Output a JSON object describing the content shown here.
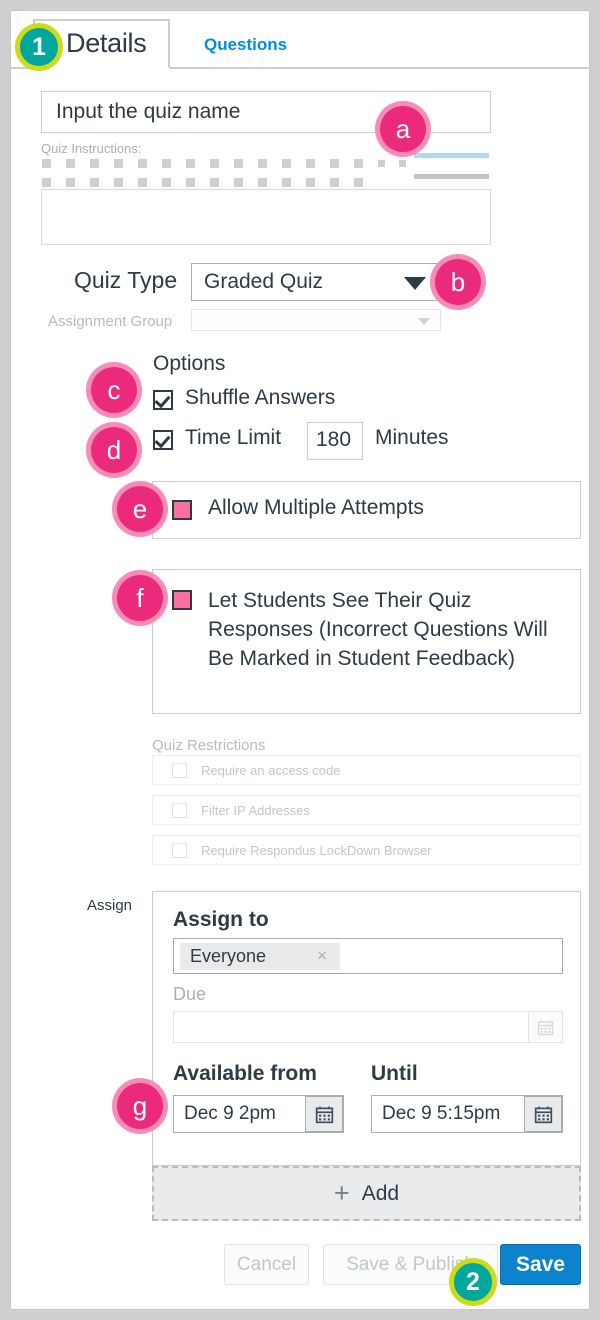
{
  "tabs": {
    "active_label": "Details",
    "inactive_label": "Questions"
  },
  "badges": {
    "one": "1",
    "two": "2",
    "a": "a",
    "b": "b",
    "c": "c",
    "d": "d",
    "e": "e",
    "f": "f",
    "g": "g"
  },
  "quiz_name": {
    "value": "Input the quiz name"
  },
  "instructions": {
    "label": "Quiz Instructions:"
  },
  "quiz_type": {
    "label": "Quiz Type",
    "value": "Graded Quiz",
    "assignment_group_label": "Assignment Group",
    "assignment_group_value": ""
  },
  "options": {
    "title": "Options",
    "shuffle_answers": "Shuffle Answers",
    "time_limit": "Time Limit",
    "time_limit_value": "180",
    "minutes": "Minutes",
    "allow_multiple_attempts": "Allow Multiple Attempts",
    "let_students_see": "Let Students See Their Quiz Responses (Incorrect Questions Will Be Marked in Student Feedback)"
  },
  "restrictions": {
    "title": "Quiz Restrictions",
    "rows": [
      "Require an access code",
      "Filter IP Addresses",
      "Require Respondus LockDown Browser"
    ]
  },
  "assign": {
    "side_label": "Assign",
    "title": "Assign to",
    "pill_label": "Everyone",
    "pill_close": "×",
    "due_label": "Due",
    "due_value": "",
    "available_from_label": "Available from",
    "available_from_value": "Dec 9  2pm",
    "until_label": "Until",
    "until_value": "Dec 9  5:15pm",
    "add_label": "Add",
    "add_plus": "+"
  },
  "footer": {
    "cancel": "Cancel",
    "save_publish": "Save & Publish",
    "save": "Save"
  },
  "colors": {
    "accent_blue": "#008ee2",
    "save_blue": "#0e83cd",
    "badge_teal": "#00a79d",
    "badge_ring_yellow": "#cddc18",
    "badge_pink": "#ec2a7b",
    "badge_pink_ring": "#f98cb6",
    "checkbox_pink": "#f86fa0",
    "text_dark": "#2d3b45",
    "text_muted": "#a9b0b5"
  }
}
